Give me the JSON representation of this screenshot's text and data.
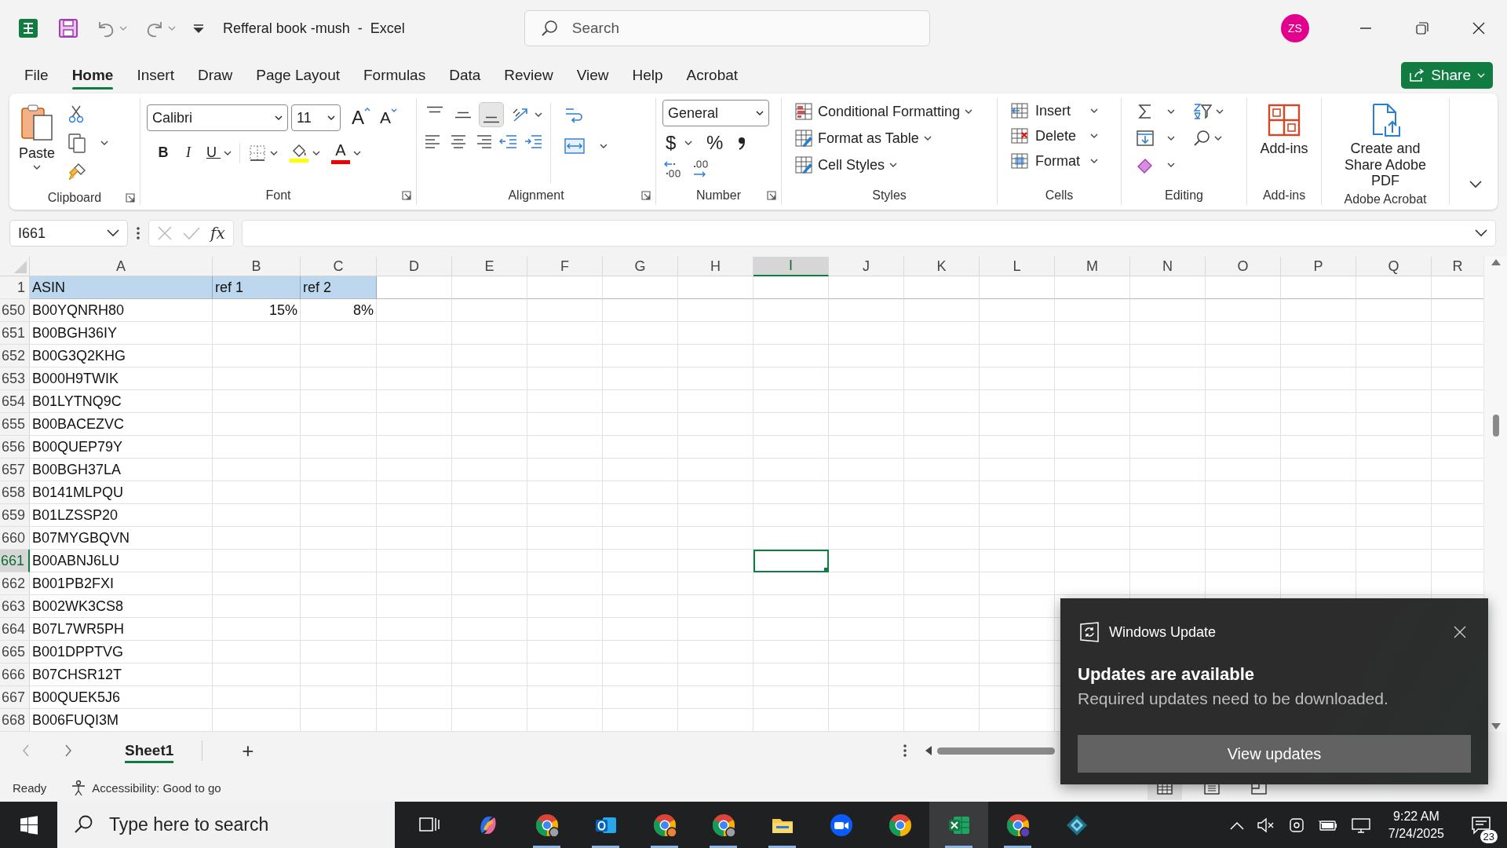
{
  "window": {
    "title": "Refferal book -mush  -  Excel",
    "search_placeholder": "Search",
    "user_initials": "ZS"
  },
  "ribbon_tabs": [
    {
      "label": "File",
      "selected": false
    },
    {
      "label": "Home",
      "selected": true
    },
    {
      "label": "Insert",
      "selected": false
    },
    {
      "label": "Draw",
      "selected": false
    },
    {
      "label": "Page Layout",
      "selected": false
    },
    {
      "label": "Formulas",
      "selected": false
    },
    {
      "label": "Data",
      "selected": false
    },
    {
      "label": "Review",
      "selected": false
    },
    {
      "label": "View",
      "selected": false
    },
    {
      "label": "Help",
      "selected": false
    },
    {
      "label": "Acrobat",
      "selected": false
    }
  ],
  "share_button": "Share",
  "ribbon": {
    "clipboard": {
      "label": "Clipboard",
      "paste": "Paste"
    },
    "font": {
      "label": "Font",
      "font_name": "Calibri",
      "font_size": "11",
      "grow": "A",
      "shrink": "A",
      "bold": "B",
      "italic": "I",
      "underline": "U",
      "font_color": "A"
    },
    "alignment": {
      "label": "Alignment",
      "vertical_align": [
        {
          "selected": false
        },
        {
          "selected": false
        },
        {
          "selected": true
        }
      ]
    },
    "number": {
      "label": "Number",
      "format": "General",
      "currency": "$",
      "percent": "%"
    },
    "styles": {
      "label": "Styles",
      "buttons": [
        "Conditional Formatting",
        "Format as Table",
        "Cell Styles"
      ]
    },
    "cells": {
      "label": "Cells",
      "buttons": [
        "Insert",
        "Delete",
        "Format"
      ]
    },
    "editing": {
      "label": "Editing"
    },
    "addins": {
      "label": "Add-ins",
      "button": "Add-ins"
    },
    "acrobat": {
      "label": "Adobe Acrobat",
      "button": "Create and Share Adobe PDF"
    }
  },
  "formula_bar": {
    "name_box": "I661",
    "fx": "fx"
  },
  "sheet": {
    "columns": [
      {
        "label": "A",
        "selected": false
      },
      {
        "label": "B",
        "selected": false
      },
      {
        "label": "C",
        "selected": false
      },
      {
        "label": "D",
        "selected": false
      },
      {
        "label": "E",
        "selected": false
      },
      {
        "label": "F",
        "selected": false
      },
      {
        "label": "G",
        "selected": false
      },
      {
        "label": "H",
        "selected": false
      },
      {
        "label": "I",
        "selected": true
      },
      {
        "label": "J",
        "selected": false
      },
      {
        "label": "K",
        "selected": false
      },
      {
        "label": "L",
        "selected": false
      },
      {
        "label": "M",
        "selected": false
      },
      {
        "label": "N",
        "selected": false
      },
      {
        "label": "O",
        "selected": false
      },
      {
        "label": "P",
        "selected": false
      },
      {
        "label": "Q",
        "selected": false
      },
      {
        "label": "R",
        "selected": false
      }
    ],
    "rows": [
      {
        "number": "1",
        "selected": false,
        "highlighted": true,
        "cells": [
          {
            "text": "ASIN",
            "kind": "text"
          },
          {
            "text": "ref 1",
            "kind": "text"
          },
          {
            "text": "ref 2",
            "kind": "text"
          }
        ]
      },
      {
        "number": "650",
        "selected": false,
        "highlighted": false,
        "cells": [
          {
            "text": "B00YQNRH80",
            "kind": "text"
          },
          {
            "text": "15%",
            "kind": "number"
          },
          {
            "text": "8%",
            "kind": "number"
          }
        ]
      },
      {
        "number": "651",
        "selected": false,
        "highlighted": false,
        "cells": [
          {
            "text": "B00BGH36IY",
            "kind": "text"
          }
        ]
      },
      {
        "number": "652",
        "selected": false,
        "highlighted": false,
        "cells": [
          {
            "text": "B00G3Q2KHG",
            "kind": "text"
          }
        ]
      },
      {
        "number": "653",
        "selected": false,
        "highlighted": false,
        "cells": [
          {
            "text": "B000H9TWIK",
            "kind": "text"
          }
        ]
      },
      {
        "number": "654",
        "selected": false,
        "highlighted": false,
        "cells": [
          {
            "text": "B01LYTNQ9C",
            "kind": "text"
          }
        ]
      },
      {
        "number": "655",
        "selected": false,
        "highlighted": false,
        "cells": [
          {
            "text": "B00BACEZVC",
            "kind": "text"
          }
        ]
      },
      {
        "number": "656",
        "selected": false,
        "highlighted": false,
        "cells": [
          {
            "text": "B00QUEP79Y",
            "kind": "text"
          }
        ]
      },
      {
        "number": "657",
        "selected": false,
        "highlighted": false,
        "cells": [
          {
            "text": "B00BGH37LA",
            "kind": "text"
          }
        ]
      },
      {
        "number": "658",
        "selected": false,
        "highlighted": false,
        "cells": [
          {
            "text": "B0141MLPQU",
            "kind": "text"
          }
        ]
      },
      {
        "number": "659",
        "selected": false,
        "highlighted": false,
        "cells": [
          {
            "text": "B01LZSSP20",
            "kind": "text"
          }
        ]
      },
      {
        "number": "660",
        "selected": false,
        "highlighted": false,
        "cells": [
          {
            "text": "B07MYGBQVN",
            "kind": "text"
          }
        ]
      },
      {
        "number": "661",
        "selected": true,
        "highlighted": false,
        "cells": [
          {
            "text": "B00ABNJ6LU",
            "kind": "text"
          }
        ]
      },
      {
        "number": "662",
        "selected": false,
        "highlighted": false,
        "cells": [
          {
            "text": "B001PB2FXI",
            "kind": "text"
          }
        ]
      },
      {
        "number": "663",
        "selected": false,
        "highlighted": false,
        "cells": [
          {
            "text": "B002WK3CS8",
            "kind": "text"
          }
        ]
      },
      {
        "number": "664",
        "selected": false,
        "highlighted": false,
        "cells": [
          {
            "text": "B07L7WR5PH",
            "kind": "text"
          }
        ]
      },
      {
        "number": "665",
        "selected": false,
        "highlighted": false,
        "cells": [
          {
            "text": "B001DPPTVG",
            "kind": "text"
          }
        ]
      },
      {
        "number": "666",
        "selected": false,
        "highlighted": false,
        "cells": [
          {
            "text": "B07CHSR12T",
            "kind": "text"
          }
        ]
      },
      {
        "number": "667",
        "selected": false,
        "highlighted": false,
        "cells": [
          {
            "text": "B00QUEK5J6",
            "kind": "text"
          }
        ]
      },
      {
        "number": "668",
        "selected": false,
        "highlighted": false,
        "cells": [
          {
            "text": "B006FUQI3M",
            "kind": "text"
          }
        ]
      }
    ]
  },
  "sheet_tabs": [
    {
      "label": "Sheet1",
      "selected": true
    }
  ],
  "add_sheet": "+",
  "status_bar": {
    "ready": "Ready",
    "accessibility": "Accessibility: Good to go",
    "view_modes": [
      {
        "selected": true
      },
      {
        "selected": false
      },
      {
        "selected": false
      }
    ]
  },
  "taskbar": {
    "search_placeholder": "Type here to search",
    "apps": [
      {
        "running": false,
        "active": false
      },
      {
        "running": false,
        "active": false
      },
      {
        "running": true,
        "active": false
      },
      {
        "running": true,
        "active": false
      },
      {
        "running": true,
        "active": false
      },
      {
        "running": true,
        "active": false
      },
      {
        "running": true,
        "active": false
      },
      {
        "running": false,
        "active": false
      },
      {
        "running": false,
        "active": false
      },
      {
        "running": true,
        "active": true
      },
      {
        "running": true,
        "active": false
      },
      {
        "running": false,
        "active": false
      }
    ],
    "time": "9:22 AM",
    "date": "7/24/2025",
    "notification_count": "23"
  },
  "notification": {
    "app": "Windows Update",
    "title": "Updates are available",
    "message": "Required updates need to be downloaded.",
    "button": "View updates"
  }
}
